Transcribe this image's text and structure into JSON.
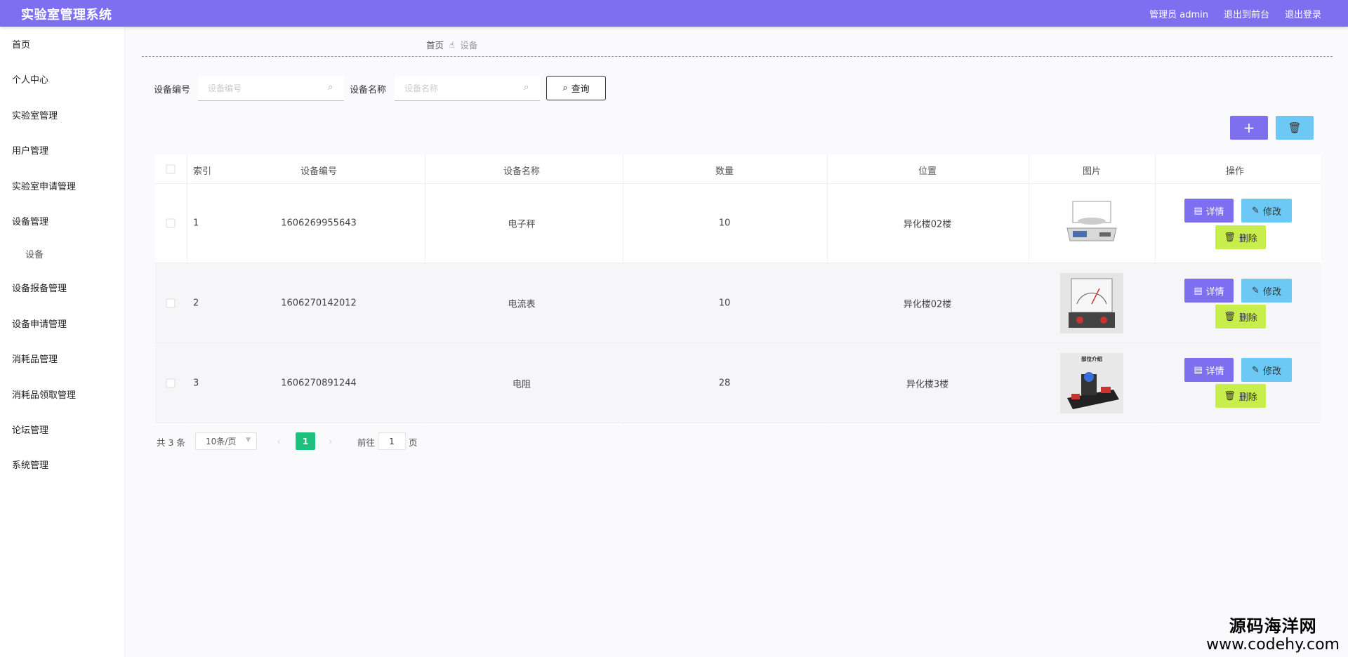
{
  "header": {
    "title": "实验室管理系统",
    "user_label": "管理员 admin",
    "back_label": "退出到前台",
    "logout_label": "退出登录"
  },
  "sidebar": {
    "items": [
      {
        "label": "首页"
      },
      {
        "label": "个人中心"
      },
      {
        "label": "实验室管理"
      },
      {
        "label": "用户管理"
      },
      {
        "label": "实验室申请管理"
      },
      {
        "label": "设备管理"
      },
      {
        "label": "设备"
      },
      {
        "label": "设备报备管理"
      },
      {
        "label": "设备申请管理"
      },
      {
        "label": "消耗品管理"
      },
      {
        "label": "消耗品领取管理"
      },
      {
        "label": "论坛管理"
      },
      {
        "label": "系统管理"
      }
    ]
  },
  "breadcrumb": {
    "home": "首页",
    "current": "设备"
  },
  "filters": {
    "code_label": "设备编号",
    "code_placeholder": "设备编号",
    "name_label": "设备名称",
    "name_placeholder": "设备名称",
    "query_label": "查询"
  },
  "toolbar": {
    "add_icon": "plus-icon",
    "delete_icon": "trash-icon"
  },
  "table": {
    "headers": [
      "索引",
      "设备编号",
      "设备名称",
      "数量",
      "位置",
      "图片",
      "操作"
    ],
    "rows": [
      {
        "index": "1",
        "code": "1606269955643",
        "name": "电子秤",
        "qty": "10",
        "location": "异化楼02楼",
        "image": "electronic-scale"
      },
      {
        "index": "2",
        "code": "1606270142012",
        "name": "电流表",
        "qty": "10",
        "location": "异化楼02楼",
        "image": "ammeter"
      },
      {
        "index": "3",
        "code": "1606270891244",
        "name": "电阻",
        "qty": "28",
        "location": "异化楼3楼",
        "image_caption": "部位介绍",
        "image": "resistor-device"
      }
    ],
    "actions": {
      "detail": "详情",
      "edit": "修改",
      "delete": "删除"
    }
  },
  "pagination": {
    "total": "共 3 条",
    "page_size": "10条/页",
    "current_page": "1",
    "goto_label": "前往",
    "goto_value": "1",
    "page_unit": "页"
  },
  "watermark": {
    "cn": "源码海洋网",
    "url": "www.codehy.com"
  },
  "colors": {
    "primary": "#7d6ff0",
    "info": "#6cc9f5",
    "warning": "#c7ee4a",
    "success": "#1ec07e"
  }
}
